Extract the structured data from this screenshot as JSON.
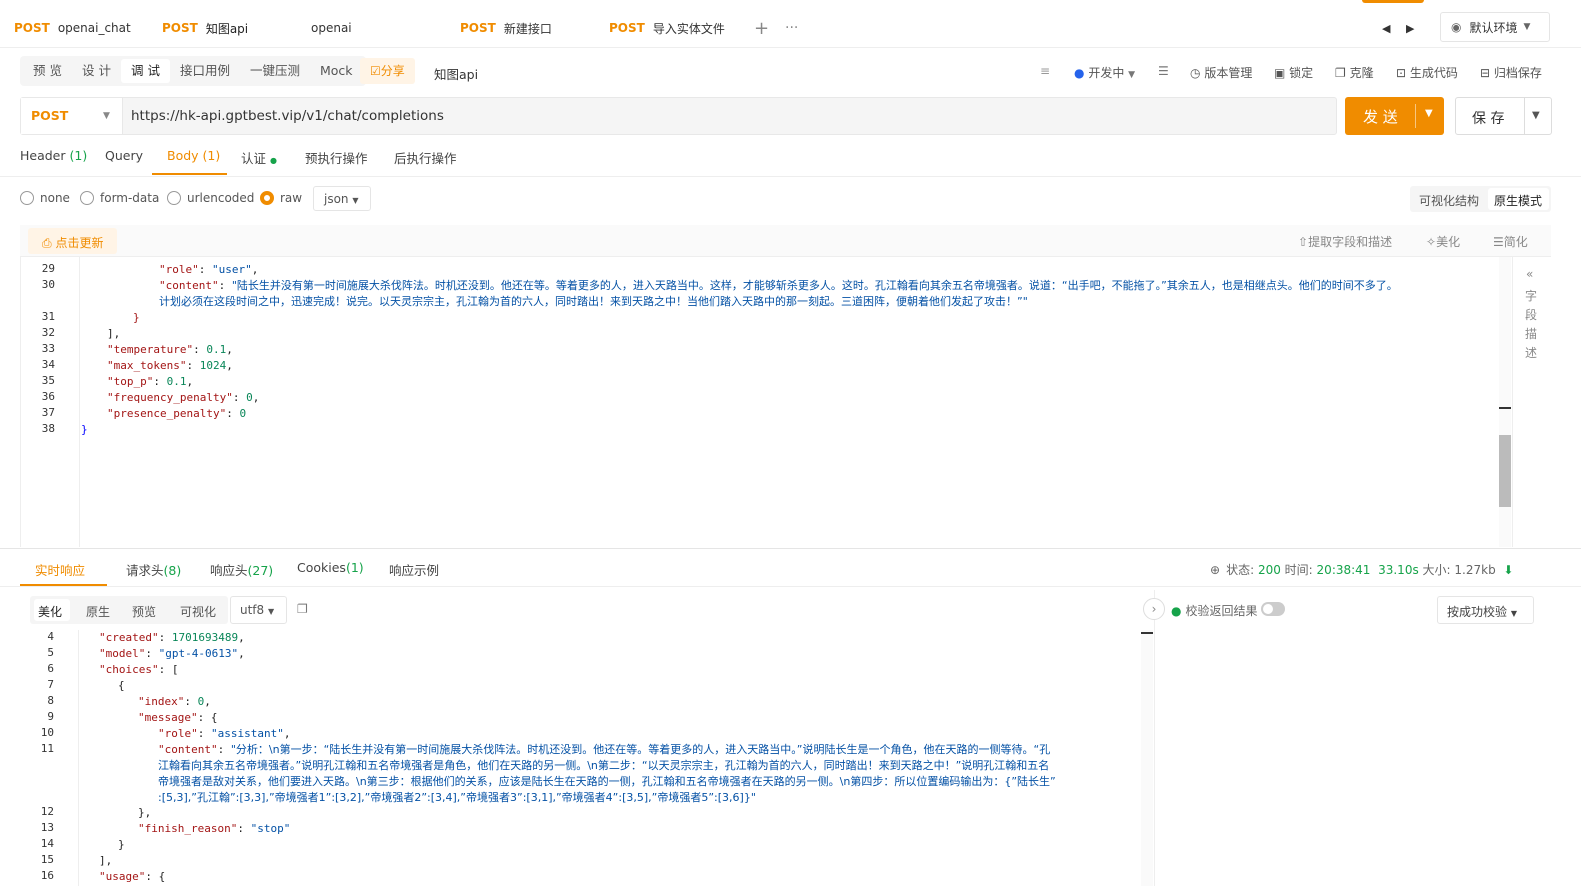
{
  "tabs": [
    {
      "method": "POST",
      "name": "openai_chat",
      "dot": true
    },
    {
      "method": "POST",
      "name": "知图api",
      "dot": true
    },
    {
      "method": "",
      "name": "openai",
      "dot": false
    },
    {
      "method": "POST",
      "name": "新建接口",
      "dot": false
    },
    {
      "method": "POST",
      "name": "导入实体文件",
      "dot": false
    }
  ],
  "env": "默认环境",
  "mode_tabs": [
    "预 览",
    "设 计",
    "调 试",
    "接口用例",
    "一键压测",
    "Mock"
  ],
  "share": "分享",
  "api_name": "知图api",
  "status": "开发中",
  "toolbar": {
    "version": "版本管理",
    "lock": "锁定",
    "clone": "克隆",
    "gencode": "生成代码",
    "archive": "归档保存"
  },
  "request": {
    "method": "POST",
    "url": "https://hk-api.gptbest.vip/v1/chat/completions",
    "send": "发 送",
    "save": "保 存"
  },
  "req_tabs": {
    "header": "Header",
    "header_count": "(1)",
    "query": "Query",
    "body": "Body (1)",
    "auth": "认证",
    "pre": "预执行操作",
    "post": "后执行操作"
  },
  "body_types": {
    "none": "none",
    "form": "form-data",
    "urlenc": "urlencoded",
    "raw": "raw",
    "format": "json"
  },
  "view_mode": {
    "visual": "可视化结构",
    "raw": "原生模式"
  },
  "update_btn": "点击更新",
  "editor_tools": {
    "extract": "提取字段和描述",
    "beautify": "美化",
    "simplify": "简化"
  },
  "side_label": "字段描述",
  "req_code": {
    "l29": "29",
    "l30": "30",
    "l31": "31",
    "l32": "32",
    "l33": "33",
    "l34": "34",
    "l35": "35",
    "l36": "36",
    "l37": "37",
    "l38": "38",
    "role_key": "\"role\"",
    "role_val": "\"user\"",
    "content_key": "\"content\"",
    "content_1": "\"陆长生并没有第一时间施展大杀伐阵法。时机还没到。他还在等。等着更多的人，进入天路当中。这样，才能够斩杀更多人。这时。孔江翰看向其余五名帝境强者。说道：“出手吧，不能拖了。”其余五人，也是相继点头。他们的时间不多了。",
    "content_2": "计划必须在这段时间之中，迅速完成！说完。以天灵宗宗主，孔江翰为首的六人，同时踏出！来到天路之中！当他们踏入天路中的那一刻起。三道困阵，便朝着他们发起了攻击！”\"",
    "temp_key": "\"temperature\"",
    "temp_val": "0.1",
    "max_key": "\"max_tokens\"",
    "max_val": "1024",
    "topp_key": "\"top_p\"",
    "topp_val": "0.1",
    "freq_key": "\"frequency_penalty\"",
    "freq_val": "0",
    "pres_key": "\"presence_penalty\"",
    "pres_val": "0"
  },
  "resp_tabs": {
    "live": "实时响应",
    "req_headers": "请求头",
    "req_headers_count": "(8)",
    "resp_headers": "响应头",
    "resp_headers_count": "(27)",
    "cookies": "Cookies",
    "cookies_count": "(1)",
    "example": "响应示例"
  },
  "resp_status": {
    "status_label": "状态:",
    "status": "200",
    "time_label": "时间:",
    "time": "20:38:41",
    "duration": "33.10s",
    "size_label": "大小:",
    "size": "1.27kb"
  },
  "resp_view": [
    "美化",
    "原生",
    "预览",
    "可视化"
  ],
  "encoding": "utf8",
  "validate": {
    "label": "校验返回结果",
    "rule": "按成功校验"
  },
  "resp_code": {
    "l4": "4",
    "l5": "5",
    "l6": "6",
    "l7": "7",
    "l8": "8",
    "l9": "9",
    "l10": "10",
    "l11": "11",
    "l12": "12",
    "l13": "13",
    "l14": "14",
    "l15": "15",
    "l16": "16",
    "created_key": "\"created\"",
    "created_val": "1701693489",
    "model_key": "\"model\"",
    "model_val": "\"gpt-4-0613\"",
    "choices_key": "\"choices\"",
    "index_key": "\"index\"",
    "index_val": "0",
    "message_key": "\"message\"",
    "role_key": "\"role\"",
    "role_val": "\"assistant\"",
    "content_key": "\"content\"",
    "c1": "\"分析：\\n第一步：“陆长生并没有第一时间施展大杀伐阵法。时机还没到。他还在等。等着更多的人，进入天路当中。”说明陆长生是一个角色，他在天路的一侧等待。“孔",
    "c2": "江翰看向其余五名帝境强者。”说明孔江翰和五名帝境强者是角色，他们在天路的另一侧。\\n第二步：“以天灵宗宗主，孔江翰为首的六人，同时踏出！来到天路之中！”说明孔江翰和五名",
    "c3": "帝境强者是敌对关系，他们要进入天路。\\n第三步：根据他们的关系，应该是陆长生在天路的一侧，孔江翰和五名帝境强者在天路的另一侧。\\n第四步：所以位置编码输出为：{”陆长生”",
    "c4": ":[5,3],”孔江翰”:[3,3],”帝境强者1”:[3,2],”帝境强者2”:[3,4],”帝境强者3”:[3,1],”帝境强者4”:[3,5],”帝境强者5”:[3,6]}\"",
    "finish_key": "\"finish_reason\"",
    "finish_val": "\"stop\"",
    "usage_key": "\"usage\""
  }
}
